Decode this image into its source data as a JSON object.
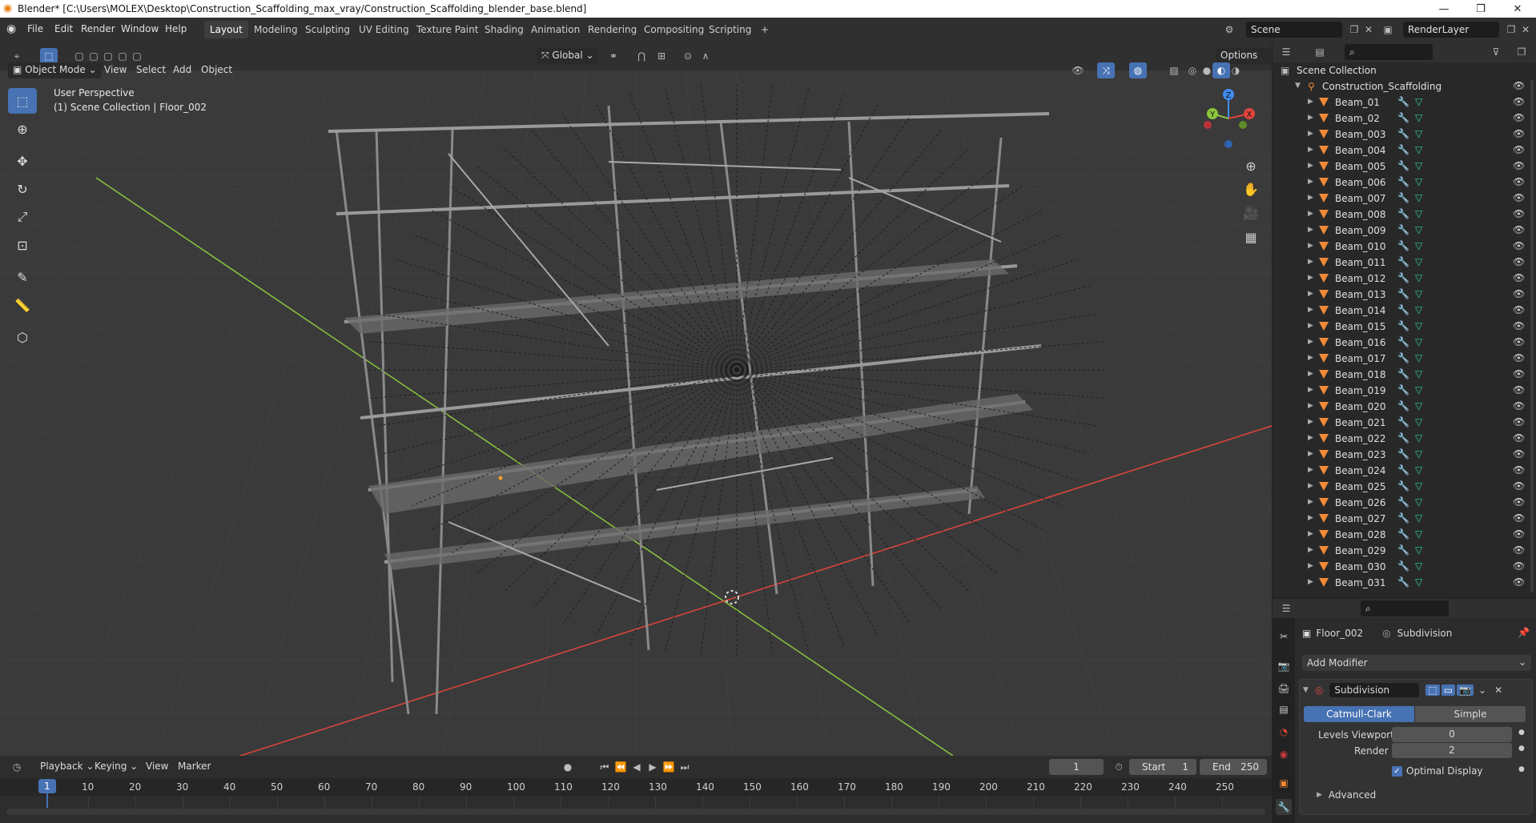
{
  "window": {
    "title": "Blender* [C:\\Users\\MOLEX\\Desktop\\Construction_Scaffolding_max_vray/Construction_Scaffolding_blender_base.blend]"
  },
  "menus": [
    "File",
    "Edit",
    "Render",
    "Window",
    "Help"
  ],
  "workspaces": [
    "Layout",
    "Modeling",
    "Sculpting",
    "UV Editing",
    "Texture Paint",
    "Shading",
    "Animation",
    "Rendering",
    "Compositing",
    "Scripting"
  ],
  "active_workspace": "Layout",
  "scene_field": "Scene",
  "renderlayer_field": "RenderLayer",
  "viewport": {
    "transform_orientation": "Global",
    "options_label": "Options",
    "mode": "Object Mode",
    "menu": [
      "View",
      "Select",
      "Add",
      "Object"
    ],
    "perspective_label": "User Perspective",
    "collection_label": "(1) Scene Collection | Floor_002",
    "gizmo_axes": {
      "x": "X",
      "y": "Y",
      "z": "Z"
    }
  },
  "outliner": {
    "root": "Scene Collection",
    "collection": "Construction_Scaffolding",
    "items": [
      "Beam_01",
      "Beam_02",
      "Beam_003",
      "Beam_004",
      "Beam_005",
      "Beam_006",
      "Beam_007",
      "Beam_008",
      "Beam_009",
      "Beam_010",
      "Beam_011",
      "Beam_012",
      "Beam_013",
      "Beam_014",
      "Beam_015",
      "Beam_016",
      "Beam_017",
      "Beam_018",
      "Beam_019",
      "Beam_020",
      "Beam_021",
      "Beam_022",
      "Beam_023",
      "Beam_024",
      "Beam_025",
      "Beam_026",
      "Beam_027",
      "Beam_028",
      "Beam_029",
      "Beam_030",
      "Beam_031"
    ]
  },
  "properties": {
    "object": "Floor_002",
    "modifier_context": "Subdivision",
    "add_modifier": "Add Modifier",
    "modifier_name": "Subdivision",
    "tab_catmull": "Catmull-Clark",
    "tab_simple": "Simple",
    "levels_viewport_label": "Levels Viewport",
    "levels_viewport_value": "0",
    "render_label": "Render",
    "render_value": "2",
    "optimal_display": "Optimal Display",
    "advanced": "Advanced"
  },
  "timeline": {
    "menu": [
      "Playback",
      "Keying",
      "View",
      "Marker"
    ],
    "current_frame": "1",
    "start_label": "Start",
    "start_value": "1",
    "end_label": "End",
    "end_value": "250",
    "ticks": [
      "1",
      "10",
      "20",
      "30",
      "40",
      "50",
      "60",
      "70",
      "80",
      "90",
      "100",
      "110",
      "120",
      "130",
      "140",
      "150",
      "160",
      "170",
      "180",
      "190",
      "200",
      "210",
      "220",
      "230",
      "240",
      "250"
    ]
  },
  "colors": {
    "accent": "#4772b3",
    "mesh_icon": "#f08a36",
    "x_axis": "#e2453c",
    "y_axis": "#8cc53e",
    "z_axis": "#3f8df0"
  }
}
